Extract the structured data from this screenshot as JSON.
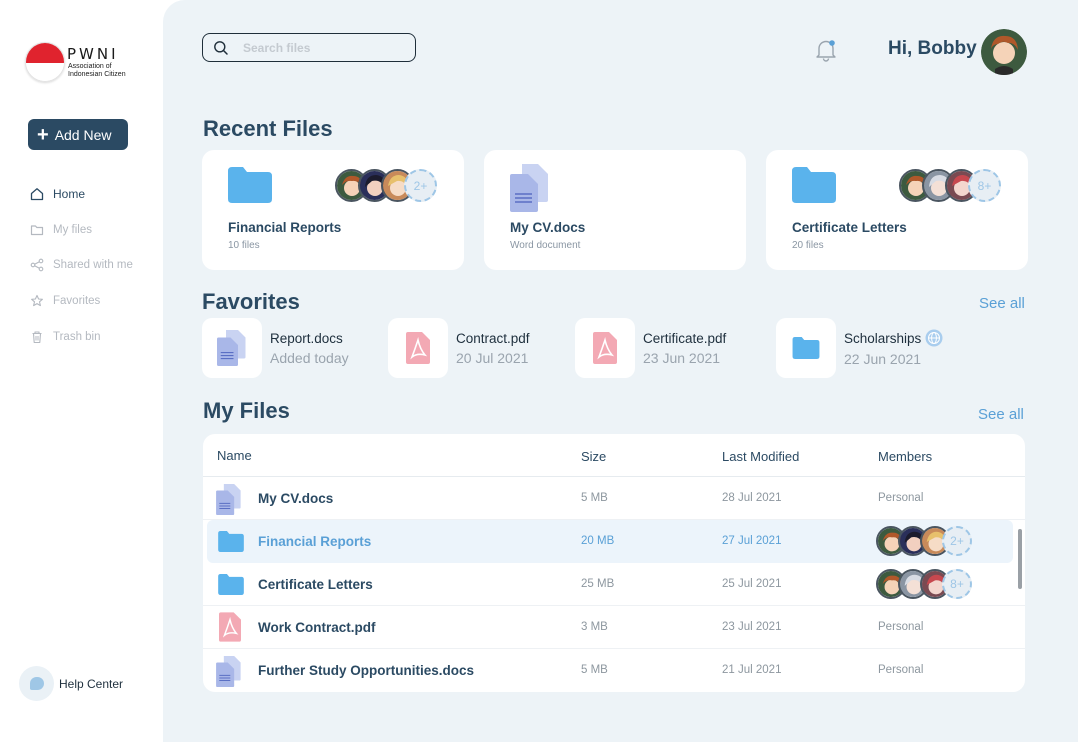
{
  "brand": {
    "name": "PWNI",
    "subtitle": "Association of Indonesian Citizen"
  },
  "sidebar": {
    "add_label": "Add New",
    "items": [
      {
        "label": "Home",
        "icon": "home-icon"
      },
      {
        "label": "My files",
        "icon": "folder-icon"
      },
      {
        "label": "Shared with me",
        "icon": "share-icon"
      },
      {
        "label": "Favorites",
        "icon": "star-icon"
      },
      {
        "label": "Trash bin",
        "icon": "trash-icon"
      }
    ],
    "help_label": "Help Center"
  },
  "header": {
    "search_placeholder": "Search files",
    "greeting": "Hi, Bobby"
  },
  "recent": {
    "title": "Recent Files",
    "cards": [
      {
        "name": "Financial Reports",
        "sub": "10 files",
        "more": "2+"
      },
      {
        "name": "My CV.docs",
        "sub": "Word document"
      },
      {
        "name": "Certificate Letters",
        "sub": "20 files",
        "more": "8+"
      }
    ]
  },
  "favorites": {
    "title": "Favorites",
    "see_all": "See all",
    "items": [
      {
        "name": "Report.docs",
        "date": "Added today"
      },
      {
        "name": "Contract.pdf",
        "date": "20 Jul 2021"
      },
      {
        "name": "Certificate.pdf",
        "date": "23 Jun 2021"
      },
      {
        "name": "Scholarships",
        "date": "22 Jun 2021"
      }
    ]
  },
  "myfiles": {
    "title": "My Files",
    "see_all": "See all",
    "columns": [
      "Name",
      "Size",
      "Last Modified",
      "Members"
    ],
    "rows": [
      {
        "name": "My CV.docs",
        "size": "5 MB",
        "date": "28 Jul 2021",
        "members": "Personal"
      },
      {
        "name": "Financial Reports",
        "size": "20 MB",
        "date": "27 Jul 2021",
        "more": "2+"
      },
      {
        "name": "Certificate Letters",
        "size": "25 MB",
        "date": "25 Jul 2021",
        "more": "8+"
      },
      {
        "name": "Work Contract.pdf",
        "size": "3 MB",
        "date": "23 Jul 2021",
        "members": "Personal"
      },
      {
        "name": "Further Study Opportunities.docs",
        "size": "5 MB",
        "date": "21 Jul 2021",
        "members": "Personal"
      }
    ]
  },
  "colors": {
    "primary": "#2b4a63",
    "accent": "#5aa0d6",
    "background": "#edf3f7",
    "pdf": "#f3a9b4",
    "doc": "#a9b7e8",
    "folder": "#5ab3ec"
  }
}
